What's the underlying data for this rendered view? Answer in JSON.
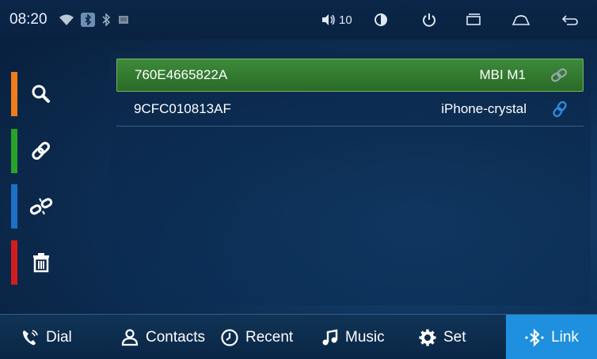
{
  "status_bar": {
    "time": "08:20",
    "volume": "10",
    "icons": [
      "wifi-icon",
      "bluetooth-badge-icon",
      "bluetooth-icon",
      "sd-card-icon",
      "volume-icon",
      "brightness-icon",
      "power-icon",
      "recent-apps-icon",
      "home-icon",
      "back-icon"
    ]
  },
  "left_rail": [
    {
      "icon": "search-icon",
      "color": "#f07c1a"
    },
    {
      "icon": "link-icon",
      "color": "#27a32a"
    },
    {
      "icon": "unlink-icon",
      "color": "#1d6fc7"
    },
    {
      "icon": "trash-icon",
      "color": "#d21d1d"
    }
  ],
  "devices": [
    {
      "address": "760E4665822A",
      "name": "MBI M1",
      "selected": true,
      "status_icon": "link-icon-gray"
    },
    {
      "address": "9CFC010813AF",
      "name": "iPhone-crystal",
      "selected": false,
      "status_icon": "link-icon-blue"
    }
  ],
  "bottom_nav": [
    {
      "label": "Dial",
      "icon": "phone-icon",
      "active": false
    },
    {
      "label": "Contacts",
      "icon": "person-icon",
      "active": false
    },
    {
      "label": "Recent",
      "icon": "clock-icon",
      "active": false
    },
    {
      "label": "Music",
      "icon": "music-note-icon",
      "active": false
    },
    {
      "label": "Set",
      "icon": "gear-icon",
      "active": false
    },
    {
      "label": "Link",
      "icon": "bluetooth-icon",
      "active": true
    }
  ],
  "colors": {
    "accent": "#1e90dd",
    "selected_row": "#2f7a2c"
  }
}
